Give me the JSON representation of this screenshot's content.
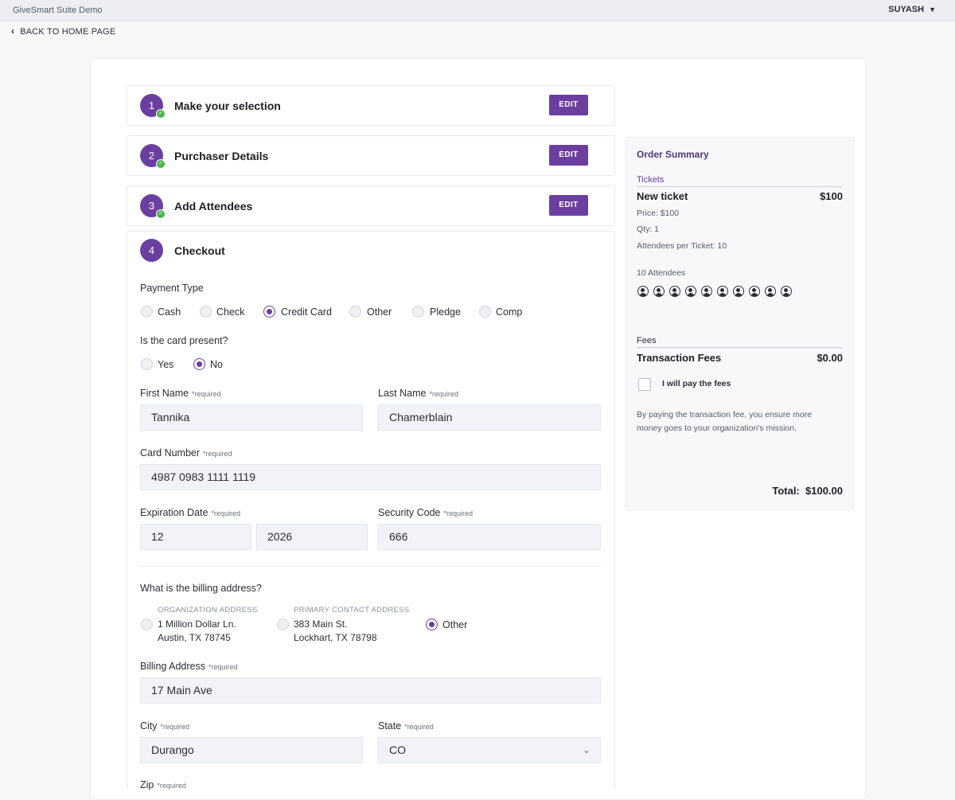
{
  "app": {
    "title": "GiveSmart Suite Demo",
    "user": "SUYASH",
    "user_caret": "▼",
    "back_label": "BACK TO HOME PAGE"
  },
  "steps": [
    {
      "number": "1",
      "title": "Make your selection",
      "edit": "EDIT",
      "completed": true
    },
    {
      "number": "2",
      "title": "Purchaser Details",
      "edit": "EDIT",
      "completed": true
    },
    {
      "number": "3",
      "title": "Add Attendees",
      "edit": "EDIT",
      "completed": true
    },
    {
      "number": "4",
      "title": "Checkout",
      "completed": false
    }
  ],
  "checkout": {
    "payment_type_label": "Payment Type",
    "payment_types": [
      "Cash",
      "Check",
      "Credit Card",
      "Other",
      "Pledge",
      "Comp"
    ],
    "payment_selected": "Credit Card",
    "card_present_label": "Is the card present?",
    "card_present_options": [
      "Yes",
      "No"
    ],
    "card_present_selected": "No",
    "required": "*required",
    "first_name_label": "First Name",
    "first_name": "Tannika",
    "last_name_label": "Last Name",
    "last_name": "Chamerblain",
    "card_number_label": "Card Number",
    "card_number": "4987 0983 1111 1119",
    "expiration_label": "Expiration Date",
    "exp_month": "12",
    "exp_year": "2026",
    "security_label": "Security Code",
    "security_code": "666",
    "billing_question": "What is the billing address?",
    "address_options": [
      {
        "caption": "ORGANIZATION ADDRESS",
        "line1": "1 Million Dollar Ln.",
        "line2": "Austin, TX 78745"
      },
      {
        "caption": "PRIMARY CONTACT ADDRESS",
        "line1": "383 Main St.",
        "line2": "Lockhart, TX 78798"
      },
      {
        "caption": "",
        "line1": "Other",
        "line2": ""
      }
    ],
    "address_selected": "Other",
    "billing_address_label": "Billing Address",
    "billing_address": "17 Main Ave",
    "city_label": "City",
    "city": "Durango",
    "state_label": "State",
    "state": "CO",
    "zip_label": "Zip"
  },
  "summary": {
    "title": "Order Summary",
    "tickets_label": "Tickets",
    "ticket_name": "New ticket",
    "ticket_amount": "$100",
    "price": "Price: $100",
    "qty": "Qty: 1",
    "attendees_per": "Attendees per Ticket: 10",
    "attendees_count": "10 Attendees",
    "attendee_icon_count": 10,
    "fees_label": "Fees",
    "transaction_fees_label": "Transaction Fees",
    "transaction_fees": "$0.00",
    "pay_fees_label": "I will pay the fees",
    "pay_fees_checked": false,
    "fee_note": "By paying the transaction fee, you ensure more money goes to your organization's mission.",
    "total_label": "Total:",
    "total": "$100.00"
  },
  "colors": {
    "accent": "#6b3fa0",
    "check_green": "#4cb84c",
    "input_bg": "#f1f3f8"
  }
}
